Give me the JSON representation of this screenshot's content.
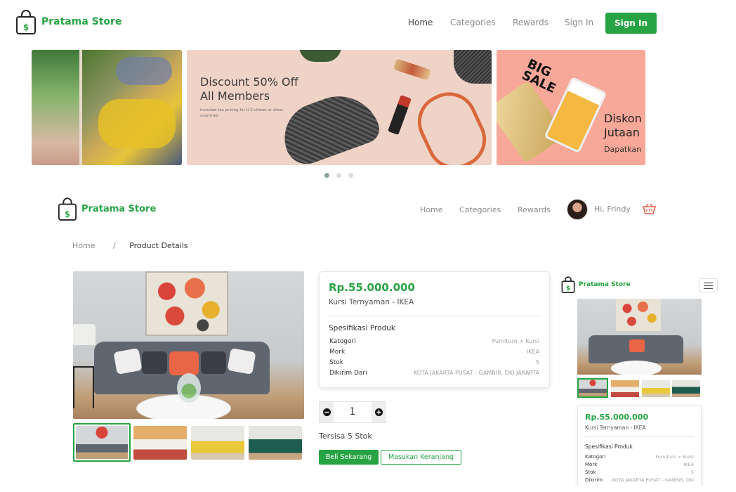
{
  "top_nav": {
    "logo_text": "Pratama Store",
    "links": [
      "Home",
      "Categories",
      "Rewards",
      "Sign In"
    ],
    "signin_button": "Sign In"
  },
  "carousel": {
    "banner_title_line1": "Discount 50% Off",
    "banner_title_line2": "All Members",
    "banner_small": "Included tax pricing for U.S citizen or other countries",
    "right_banner_line1": "Diskon",
    "right_banner_line2": "Jutaan",
    "right_banner_line3": "Dapatkan",
    "big_sale": "BIG SALE",
    "slide_count": 3,
    "active_slide": 1
  },
  "app_nav": {
    "logo_text": "Pratama Store",
    "links": [
      "Home",
      "Categories",
      "Rewards"
    ],
    "greeting": "Hi, Frindy"
  },
  "breadcrumb": {
    "home": "Home",
    "separator": "/",
    "current": "Product Details"
  },
  "product": {
    "price": "Rp.55.000.000",
    "name": "Kursi Ternyaman - IKEA",
    "spec_title": "Spesifikasi Produk",
    "specs": [
      {
        "key": "Katogori",
        "value": "Furnituro > Kursi"
      },
      {
        "key": "Mork",
        "value": "IKEA"
      },
      {
        "key": "Stok",
        "value": "5"
      },
      {
        "key": "Dikirim Dari",
        "value": "KOTA JAKARTA PUSAT - GAMBIR, DKI JAKARTA"
      }
    ],
    "quantity": "1",
    "remaining": "Tersisa 5 Stok",
    "buy_button": "Beli Sekarang",
    "cart_button": "Masukan Keranjang"
  },
  "mobile": {
    "logo_text": "Pratama Store",
    "price": "Rp.55.000.000",
    "name": "Kursi Ternyaman - IKEA",
    "spec_title": "Spesifikasi Produk",
    "specs": [
      {
        "key": "Katogori",
        "value": "Furnituro > Kursi"
      },
      {
        "key": "Mork",
        "value": "IKEA"
      },
      {
        "key": "Stok",
        "value": "5"
      },
      {
        "key": "Dikirim",
        "value": "KOTA JAKARTA PUSAT - GAMBIR, DKI"
      }
    ]
  },
  "colors": {
    "brand_green": "#27a344",
    "cart_icon": "#e8604c"
  }
}
